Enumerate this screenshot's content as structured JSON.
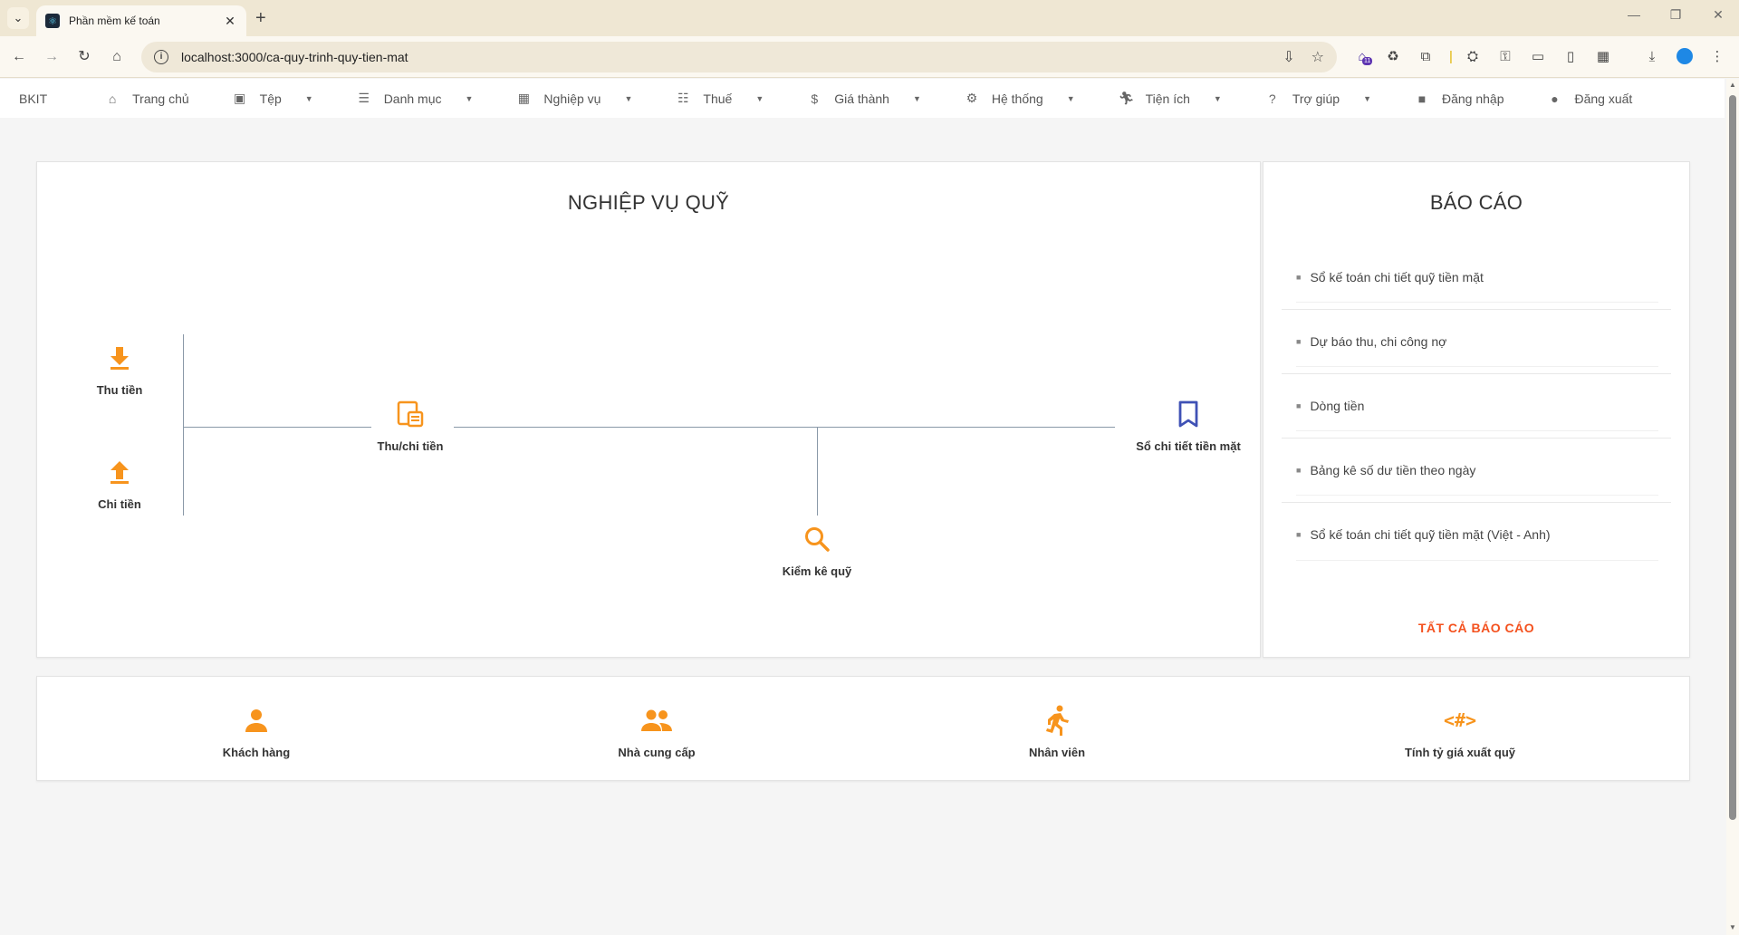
{
  "browser": {
    "tab_title": "Phần mềm kế toán",
    "tab_close": "✕",
    "new_tab": "+",
    "url": "localhost:3000/ca-quy-trinh-quy-tien-mat",
    "badge_count": "11"
  },
  "nav": {
    "brand": "BKIT",
    "items": [
      {
        "label": "Trang chủ",
        "icon": "home-icon",
        "caret": false
      },
      {
        "label": "Tệp",
        "icon": "save-icon",
        "caret": true
      },
      {
        "label": "Danh mục",
        "icon": "list-icon",
        "caret": true
      },
      {
        "label": "Nghiệp vụ",
        "icon": "grid-icon",
        "caret": true
      },
      {
        "label": "Thuế",
        "icon": "checklist-icon",
        "caret": true
      },
      {
        "label": "Giá thành",
        "icon": "dollar-icon",
        "caret": true
      },
      {
        "label": "Hệ thống",
        "icon": "gear-icon",
        "caret": true
      },
      {
        "label": "Tiện ích",
        "icon": "runner-icon",
        "caret": true
      },
      {
        "label": "Trợ giúp",
        "icon": "help-icon",
        "caret": true
      },
      {
        "label": "Đăng nhập",
        "icon": "square-icon",
        "caret": false
      },
      {
        "label": "Đăng xuất",
        "icon": "circle-icon",
        "caret": false
      }
    ]
  },
  "flow": {
    "title": "NGHIỆP VỤ QUỸ",
    "nodes": {
      "thu_tien": "Thu tiền",
      "chi_tien": "Chi tiền",
      "thu_chi": "Thu/chi tiền",
      "so_chi_tiet": "Sổ chi tiết tiền mặt",
      "kiem_ke": "Kiểm kê quỹ"
    }
  },
  "reports": {
    "title": "BÁO CÁO",
    "items": [
      "Sổ kế toán chi tiết quỹ tiền mặt",
      "Dự báo thu, chi công nợ",
      "Dòng tiền",
      "Bảng kê số dư tiền theo ngày",
      "Sổ kế toán chi tiết quỹ tiền mặt (Việt - Anh)"
    ],
    "all_label": "TẤT CẢ BÁO CÁO"
  },
  "quick_links": [
    {
      "label": "Khách hàng",
      "icon": "person-icon"
    },
    {
      "label": "Nhà cung cấp",
      "icon": "group-icon"
    },
    {
      "label": "Nhân viên",
      "icon": "runner-icon"
    },
    {
      "label": "Tính tỷ giá xuất quỹ",
      "icon": "code-hash-icon"
    }
  ],
  "colors": {
    "accent_orange": "#f7941d",
    "bookmark_blue": "#3f51b5",
    "link_red": "#f4511e"
  }
}
